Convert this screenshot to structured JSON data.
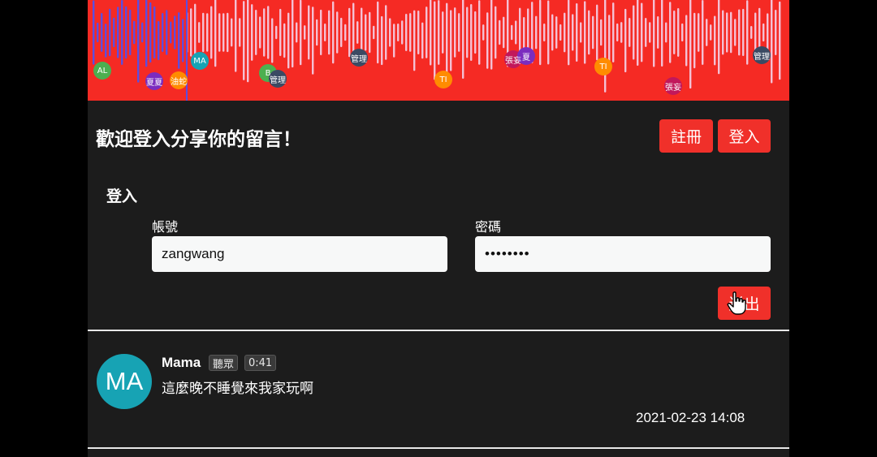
{
  "waveform": {
    "played_color": "#5b4ee0",
    "unplayed_color": "#f4c0d4",
    "background": "#f52a24",
    "played_fraction": 0.14,
    "markers": [
      {
        "label": "AL",
        "color": "#4caf50"
      },
      {
        "label": "夏夏",
        "color": "#7b2cbf"
      },
      {
        "label": "油蛇",
        "color": "#ff8c00"
      },
      {
        "label": "MA",
        "color": "#17a3b4"
      },
      {
        "label": "B",
        "color": "#4caf50"
      },
      {
        "label": "管理",
        "color": "#3b4a63"
      },
      {
        "label": "管理",
        "color": "#3b4a63"
      },
      {
        "label": "TI",
        "color": "#ff8c00"
      },
      {
        "label": "張妄",
        "color": "#c2185b"
      },
      {
        "label": "夏",
        "color": "#7b2cbf"
      },
      {
        "label": "TI",
        "color": "#ff8c00"
      },
      {
        "label": "張妄",
        "color": "#c2185b"
      },
      {
        "label": "管理",
        "color": "#3b4a63"
      }
    ]
  },
  "header": {
    "title": "歡迎登入分享你的留言！",
    "register_label": "註冊",
    "login_label": "登入"
  },
  "login_form": {
    "heading": "登入",
    "username_label": "帳號",
    "username_value": "zangwang",
    "password_label": "密碼",
    "password_value": "••••••••",
    "submit_label": "送出"
  },
  "comment": {
    "avatar_initials": "MA",
    "avatar_color": "#17a3b4",
    "author": "Mama",
    "role_tag": "聽眾",
    "time_tag": "0:41",
    "body": "這麼晚不睡覺來我家玩啊",
    "timestamp": "2021-02-23 14:08"
  }
}
